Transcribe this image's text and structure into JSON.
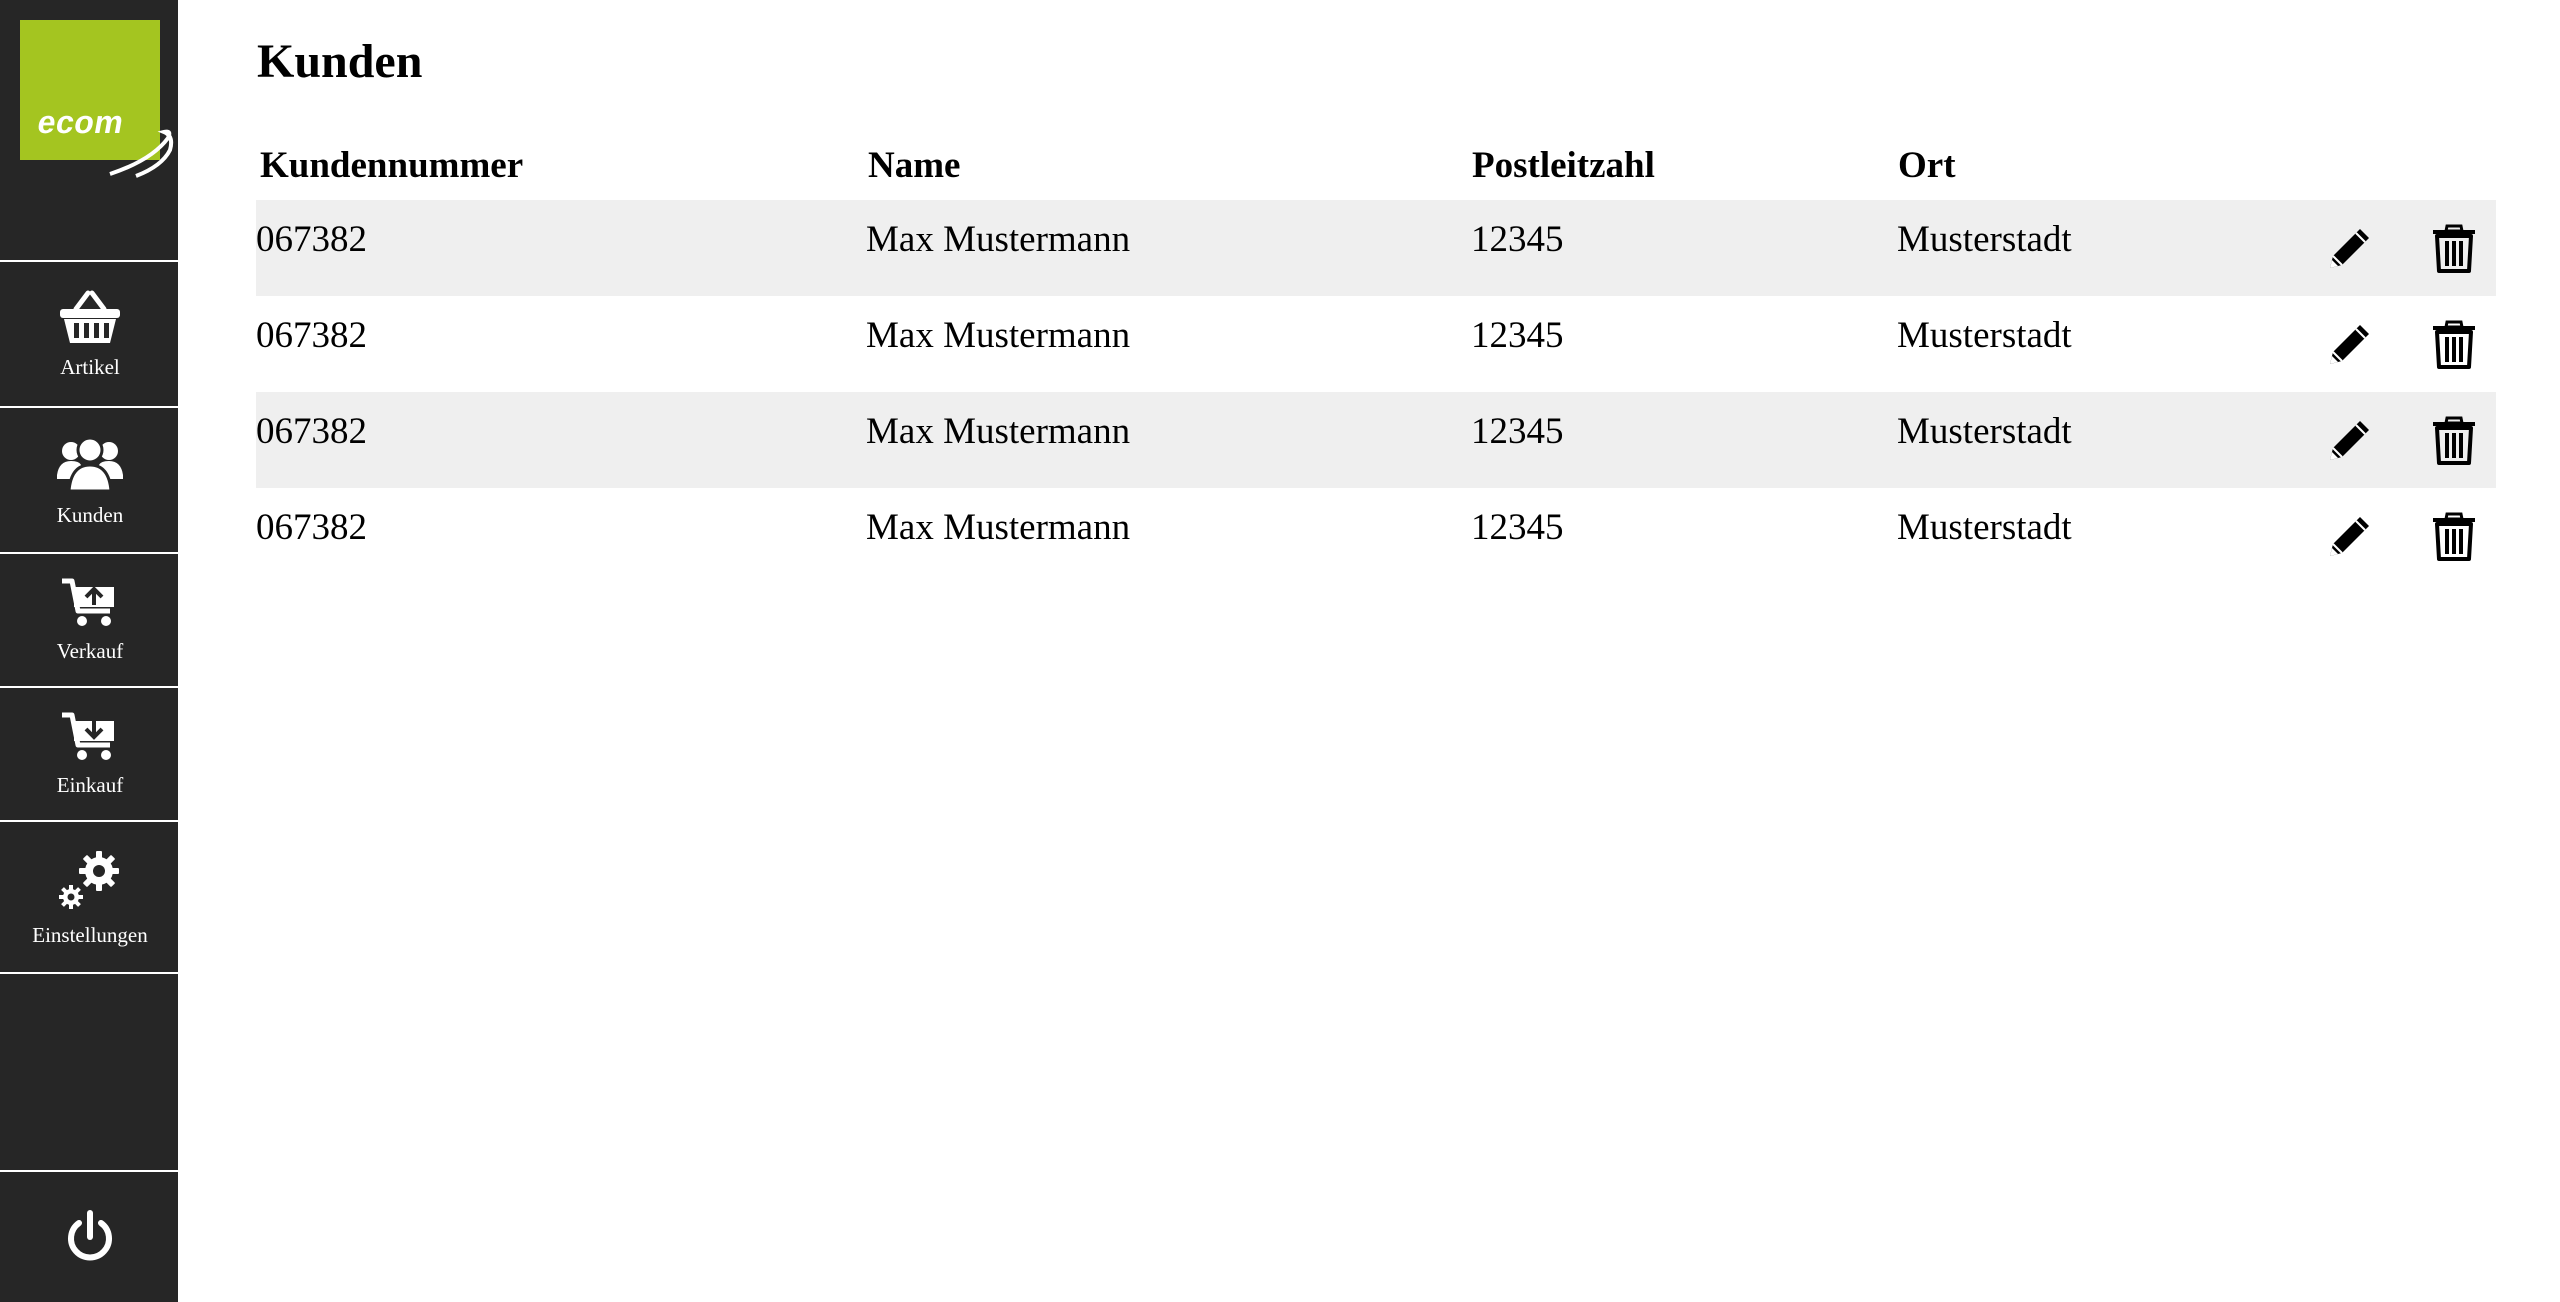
{
  "app": {
    "logo_text": "ecom"
  },
  "sidebar": {
    "items": [
      {
        "label": "Artikel",
        "icon": "basket-icon"
      },
      {
        "label": "Kunden",
        "icon": "users-icon"
      },
      {
        "label": "Verkauf",
        "icon": "cart-upload-icon"
      },
      {
        "label": "Einkauf",
        "icon": "cart-download-icon"
      },
      {
        "label": "Einstellungen",
        "icon": "gears-icon"
      }
    ],
    "power_icon": "power-icon"
  },
  "main": {
    "title": "Kunden",
    "columns": [
      "Kundennummer",
      "Name",
      "Postleitzahl",
      "Ort"
    ],
    "rows": [
      {
        "number": "067382",
        "name": "Max Mustermann",
        "zip": "12345",
        "city": "Musterstadt"
      },
      {
        "number": "067382",
        "name": "Max Mustermann",
        "zip": "12345",
        "city": "Musterstadt"
      },
      {
        "number": "067382",
        "name": "Max Mustermann",
        "zip": "12345",
        "city": "Musterstadt"
      },
      {
        "number": "067382",
        "name": "Max Mustermann",
        "zip": "12345",
        "city": "Musterstadt"
      }
    ],
    "row_actions": [
      "pencil-icon",
      "trash-icon"
    ]
  },
  "colors": {
    "brand": "#a4c520",
    "sidebar_bg": "#262626",
    "row_shade": "#efefef"
  }
}
